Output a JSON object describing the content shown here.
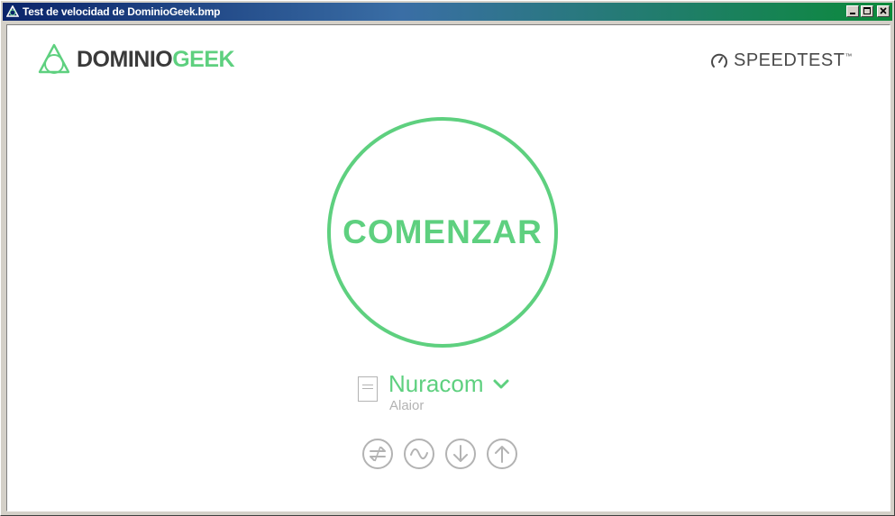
{
  "window": {
    "title": "Test de velocidad de DominioGeek.bmp"
  },
  "header": {
    "logo": {
      "part1": "DOMINIO",
      "part2": "GEEK"
    },
    "provider": {
      "label": "SPEEDTEST",
      "mark": "™",
      "icon": "gauge-icon"
    }
  },
  "main": {
    "start_label": "COMENZAR"
  },
  "server": {
    "name": "Nuracom",
    "location": "Alaior",
    "icon": "document-icon"
  },
  "bottom_icons": [
    "connections-icon",
    "ping-wave-icon",
    "download-icon",
    "upload-icon"
  ],
  "colors": {
    "accent": "#5ed07f",
    "text_dark": "#3a3a3a",
    "muted": "#b3b3b3",
    "titlebar_start": "#0a246a",
    "titlebar_end": "#0b8a3a"
  }
}
